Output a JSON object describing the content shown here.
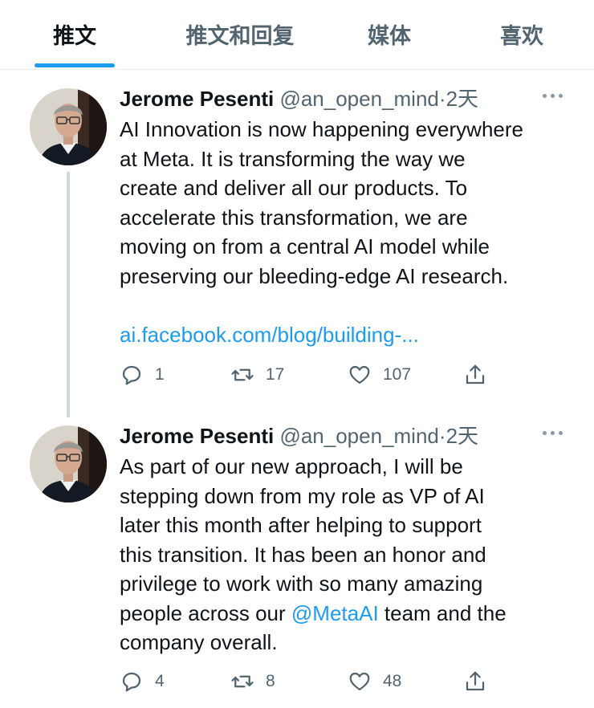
{
  "tabs": [
    {
      "label": "推文",
      "active": true
    },
    {
      "label": "推文和回复",
      "active": false
    },
    {
      "label": "媒体",
      "active": false
    },
    {
      "label": "喜欢",
      "active": false
    }
  ],
  "tweets": [
    {
      "name": "Jerome Pesenti",
      "handle": "@an_open_mind",
      "separator": "·",
      "time": "2天",
      "lines": [
        "AI Innovation is now happening everywhere",
        "at Meta. It is transforming the way we",
        "create and deliver all our products. To",
        "accelerate this transformation, we are",
        "moving on from a central AI model while",
        "preserving our bleeding-edge AI research."
      ],
      "link": "ai.facebook.com/blog/building-...",
      "replies": "1",
      "retweets": "17",
      "likes": "107"
    },
    {
      "name": "Jerome Pesenti",
      "handle": "@an_open_mind",
      "separator": "·",
      "time": "2天",
      "lines": [
        "As part of our new approach, I will be",
        "stepping down from my role as VP of AI",
        "later this month after helping to support",
        "this transition. It has been an honor and",
        "privilege to work with so many amazing"
      ],
      "line6_before": "people across our ",
      "mention": "@MetaAI",
      "line6_after": " team and the",
      "line7": "company overall.",
      "replies": "4",
      "retweets": "8",
      "likes": "48"
    }
  ],
  "icons": {
    "reply": "reply-icon",
    "retweet": "retweet-icon",
    "like": "heart-icon",
    "share": "share-icon",
    "more": "more-icon"
  },
  "colors": {
    "accent": "#1d9bf0",
    "secondary_text": "#536471",
    "primary_text": "#0f1419"
  }
}
